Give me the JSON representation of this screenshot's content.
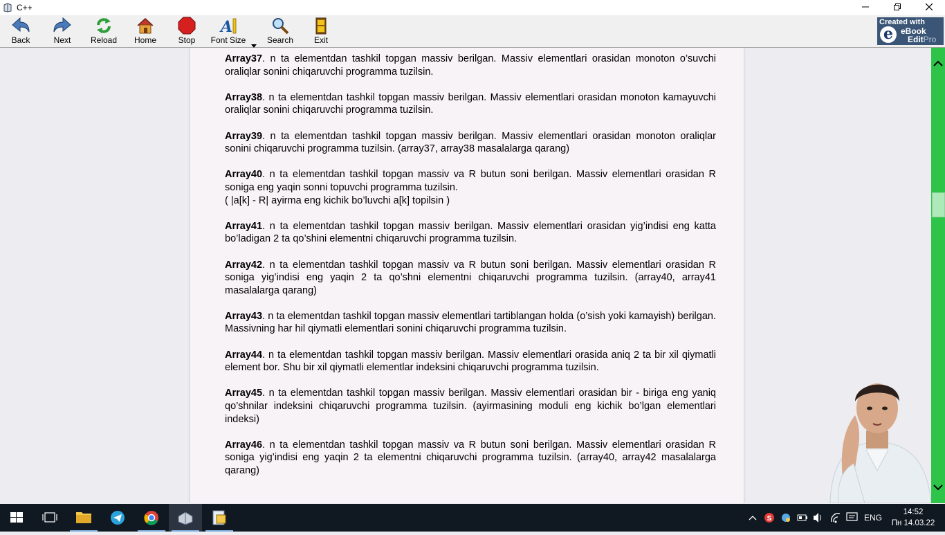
{
  "window": {
    "title": "C++"
  },
  "toolbar": {
    "buttons": [
      {
        "label": "Back"
      },
      {
        "label": "Next"
      },
      {
        "label": "Reload"
      },
      {
        "label": "Home"
      },
      {
        "label": "Stop"
      },
      {
        "label": "Font Size"
      },
      {
        "label": "Search"
      },
      {
        "label": "Exit"
      }
    ],
    "logo": {
      "line1": "Created with",
      "line2": "eBook",
      "line3a": "Edit",
      "line3b": "Pro",
      "letter": "e"
    }
  },
  "problems": [
    {
      "id": "Array37",
      "text": ". n ta elementdan tashkil topgan massiv berilgan. Massiv elementlari orasidan monoton o’suvchi oraliqlar sonini chiqaruvchi programma tuzilsin."
    },
    {
      "id": "Array38",
      "text": ". n ta elementdan tashkil topgan massiv berilgan. Massiv elementlari orasidan monoton kamayuvchi oraliqlar sonini chiqaruvchi programma tuzilsin."
    },
    {
      "id": "Array39",
      "text": ". n ta elementdan tashkil topgan massiv berilgan. Massiv elementlari orasidan monoton oraliqlar sonini chiqaruvchi programma tuzilsin. (array37, array38 masalalarga qarang)"
    },
    {
      "id": "Array40",
      "text": ". n ta elementdan tashkil topgan massiv va R butun soni berilgan. Massiv elementlari orasidan R soniga eng yaqin sonni topuvchi programma tuzilsin.",
      "extra": "( |a[k] - R| ayirma eng kichik bo’luvchi a[k] topilsin )"
    },
    {
      "id": "Array41",
      "text": ". n ta elementdan tashkil topgan massiv berilgan. Massiv elementlari orasidan yig’indisi eng katta bo’ladigan 2 ta qo’shini elementni chiqaruvchi programma tuzilsin."
    },
    {
      "id": "Array42",
      "text": ". n ta elementdan tashkil topgan massiv va R butun soni berilgan. Massiv elementlari orasidan R soniga yig’indisi eng yaqin 2 ta qo’shni elementni chiqaruvchi programma tuzilsin. (array40, array41 masalalarga qarang)"
    },
    {
      "id": "Array43",
      "text": ". n ta elementdan tashkil topgan massiv elementlari tartiblangan holda (o’sish yoki kamayish) berilgan. Massivning har hil qiymatli elementlari sonini chiqaruvchi programma tuzilsin."
    },
    {
      "id": "Array44",
      "text": ". n ta elementdan tashkil topgan massiv berilgan. Massiv elementlari orasida aniq 2 ta bir xil qiymatli element bor. Shu bir xil qiymatli elementlar indeksini chiqaruvchi programma tuzilsin."
    },
    {
      "id": "Array45",
      "text": ". n ta elementdan tashkil topgan massiv berilgan. Massiv elementlari orasidan bir - biriga  eng yaniq qo’shnilar indeksini chiqaruvchi programma tuzilsin. (ayirmasining moduli eng kichik bo’lgan elementlari indeksi)"
    },
    {
      "id": "Array46",
      "text": ". n ta elementdan tashkil topgan massiv va R butun soni berilgan. Massiv elementlari orasidan R soniga yig’indisi eng yaqin 2 ta elementni chiqaruvchi programma tuzilsin. (array40, array42 masalalarga qarang)"
    }
  ],
  "taskbar": {
    "tray": {
      "lang": "ENG",
      "time": "14:52",
      "date": "Пн 14.03.22"
    }
  }
}
